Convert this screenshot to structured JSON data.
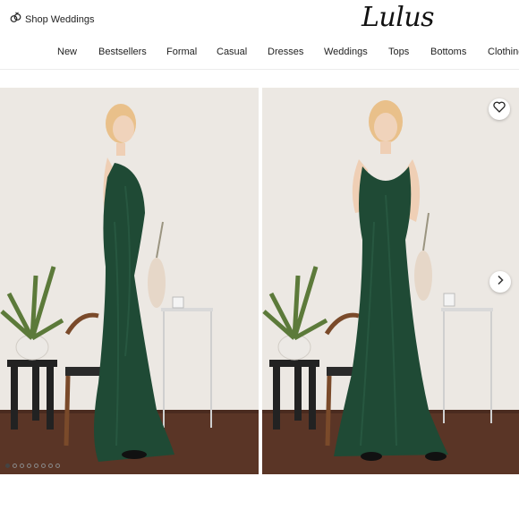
{
  "header": {
    "shop_weddings": {
      "label": "Shop Weddings",
      "icon": "rings-icon"
    },
    "logo": "Lulus"
  },
  "nav": {
    "items": [
      {
        "label": "New"
      },
      {
        "label": "Bestsellers"
      },
      {
        "label": "Formal"
      },
      {
        "label": "Casual"
      },
      {
        "label": "Dresses"
      },
      {
        "label": "Weddings"
      },
      {
        "label": "Tops"
      },
      {
        "label": "Bottoms"
      },
      {
        "label": "Clothing"
      }
    ]
  },
  "gallery": {
    "images": [
      {
        "description_icon": "product-photo-side-view"
      },
      {
        "description_icon": "product-photo-front-view"
      }
    ],
    "favorite_icon": "heart-icon",
    "next_icon": "chevron-right-icon",
    "dots": {
      "total": 8,
      "active_index": 0
    },
    "colors": {
      "dress": "#1f4a35",
      "wall": "#ece8e3",
      "floor": "#5a3526"
    }
  }
}
